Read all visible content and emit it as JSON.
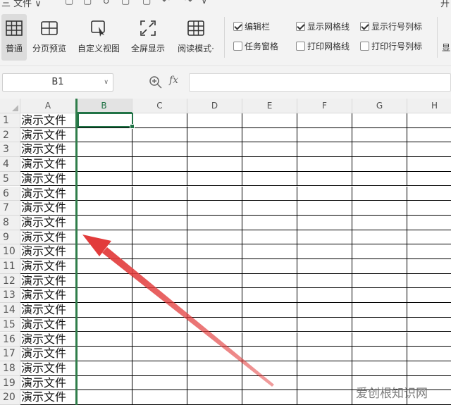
{
  "titlebar": {
    "menu_label": "三 文件 ∨",
    "right_cut_label": "开"
  },
  "ribbon": {
    "buttons": [
      {
        "label": "普通",
        "icon": "normal-view-icon",
        "active": true
      },
      {
        "label": "分页预览",
        "icon": "page-break-preview-icon",
        "active": false
      },
      {
        "label": "自定义视图",
        "icon": "custom-view-icon",
        "active": false
      },
      {
        "label": "全屏显示",
        "icon": "fullscreen-icon",
        "active": false
      },
      {
        "label": "阅读模式·",
        "icon": "reading-mode-icon",
        "active": false
      }
    ],
    "checkboxes": [
      {
        "label": "编辑栏",
        "checked": true
      },
      {
        "label": "任务窗格",
        "checked": false
      },
      {
        "label": "显示网格线",
        "checked": true
      },
      {
        "label": "打印网格线",
        "checked": false
      },
      {
        "label": "显示行号列标",
        "checked": true
      },
      {
        "label": "打印行号列标",
        "checked": false
      }
    ],
    "cut_right_label": "显"
  },
  "formula_bar": {
    "name_box": "B1",
    "fx_label": "fx",
    "formula_value": ""
  },
  "grid": {
    "columns": [
      "A",
      "B",
      "C",
      "D",
      "E",
      "F",
      "G",
      "H"
    ],
    "selected_column": "B",
    "selected_cell": "B1",
    "rows": [
      "1",
      "2",
      "3",
      "4",
      "5",
      "6",
      "7",
      "8",
      "9",
      "10",
      "11",
      "12",
      "13",
      "14",
      "15",
      "16",
      "17",
      "18",
      "19",
      "20"
    ],
    "column_a_value": "演示文件",
    "accent_color": "#217346",
    "annotation_arrow_color": "#e23b3b"
  },
  "watermark": {
    "text": "爱创根知识网"
  }
}
